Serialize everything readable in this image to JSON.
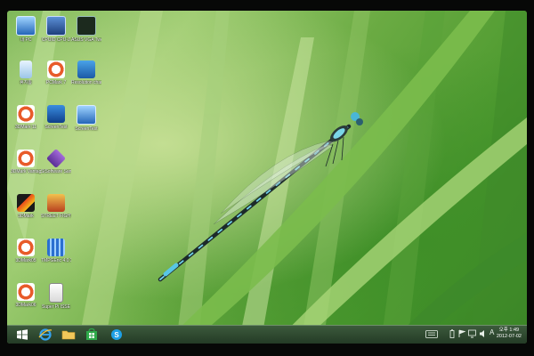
{
  "desktop": {
    "icons": [
      {
        "label": "내 PC",
        "icon": "computer-icon"
      },
      {
        "label": "CPUID CPU-Z",
        "icon": "cpuz-icon"
      },
      {
        "label": "ASUS VGA Tweak",
        "icon": "vga-tweak-icon"
      },
      {
        "label": "휴지통",
        "icon": "recycle-bin-icon"
      },
      {
        "label": "PCMark 7",
        "icon": "pcmark-icon"
      },
      {
        "label": "Resolution changer",
        "icon": "resolution-icon"
      },
      {
        "label": "3DMark 11",
        "icon": "3dmark-icon"
      },
      {
        "label": "ScreenTest",
        "icon": "screentest-icon"
      },
      {
        "label": "ScreenTest",
        "icon": "screentest-monitor-icon"
      },
      {
        "label": "3DMark Vantage",
        "icon": "3dmark-vantage-icon"
      },
      {
        "label": "SiSoftware Sandra",
        "icon": "sandra-icon"
      },
      {
        "label": "3DMark",
        "icon": "3dmark-fire-icon"
      },
      {
        "label": "STREET FIGHTER IV",
        "icon": "street-fighter-icon"
      },
      {
        "label": "3DMark05",
        "icon": "3dmark05-icon"
      },
      {
        "label": "TMPGEnc 4.0 XPress",
        "icon": "tmpgenc-icon"
      },
      {
        "label": "3DMark06",
        "icon": "3dmark06-icon"
      },
      {
        "label": "Super Pi ISSE",
        "icon": "super-pi-icon"
      }
    ]
  },
  "taskbar": {
    "pinned": [
      {
        "name": "start",
        "icon": "windows-start-icon"
      },
      {
        "name": "internet-explorer",
        "icon": "internet-explorer-icon"
      },
      {
        "name": "file-explorer",
        "icon": "folder-icon"
      },
      {
        "name": "store",
        "icon": "store-icon"
      },
      {
        "name": "skype",
        "icon": "skype-icon"
      }
    ],
    "tray": {
      "ime": "A",
      "clock_time": "오후 1:49",
      "clock_date": "2012-07-02"
    }
  },
  "colors": {
    "taskbar": "#2d472e",
    "wallpaper_green": "#6bab43",
    "accent_blue": "#1f8ad8"
  }
}
